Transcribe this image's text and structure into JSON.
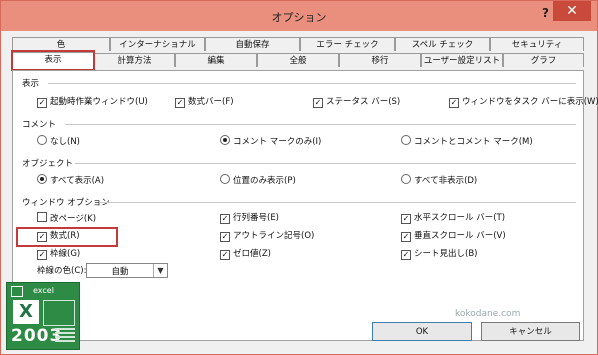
{
  "window": {
    "title": "オプション",
    "help_label": "?",
    "close_label": "✕"
  },
  "tabs_back": [
    "色",
    "インターナショナル",
    "自動保存",
    "エラー チェック",
    "スペル チェック",
    "セキュリティ"
  ],
  "tabs_front": [
    "表示",
    "計算方法",
    "編集",
    "全般",
    "移行",
    "ユーザー設定リスト",
    "グラフ"
  ],
  "active_tab": "表示",
  "sections": {
    "display": "表示",
    "comment": "コメント",
    "object": "オブジェクト",
    "window_options": "ウィンドウ オプション"
  },
  "display_items": [
    {
      "label": "起動時作業ウィンドウ(U)",
      "checked": true
    },
    {
      "label": "数式バー(F)",
      "checked": true
    },
    {
      "label": "ステータス バー(S)",
      "checked": true
    },
    {
      "label": "ウィンドウをタスク バーに表示(W)",
      "checked": true
    }
  ],
  "comment_items": [
    {
      "label": "なし(N)",
      "selected": false
    },
    {
      "label": "コメント マークのみ(I)",
      "selected": true
    },
    {
      "label": "コメントとコメント マーク(M)",
      "selected": false
    }
  ],
  "object_items": [
    {
      "label": "すべて表示(A)",
      "selected": true
    },
    {
      "label": "位置のみ表示(P)",
      "selected": false
    },
    {
      "label": "すべて非表示(D)",
      "selected": false
    }
  ],
  "window_items": [
    {
      "label": "改ページ(K)",
      "checked": false
    },
    {
      "label": "行列番号(E)",
      "checked": true
    },
    {
      "label": "水平スクロール バー(T)",
      "checked": true
    },
    {
      "label": "数式(R)",
      "checked": true
    },
    {
      "label": "アウトライン記号(O)",
      "checked": true
    },
    {
      "label": "垂直スクロール バー(V)",
      "checked": true
    },
    {
      "label": "枠線(G)",
      "checked": true
    },
    {
      "label": "ゼロ値(Z)",
      "checked": true
    },
    {
      "label": "シート見出し(B)",
      "checked": true
    }
  ],
  "gridline_color": {
    "label": "枠線の色(C):",
    "value": "自動"
  },
  "buttons": {
    "ok": "OK",
    "cancel": "キャンセル"
  },
  "watermark": "kokodane.com",
  "logo": {
    "label": "excel",
    "letter": "X",
    "year": "2003"
  },
  "colors": {
    "title_bar": "#ea8f7e",
    "close_button": "#c94a3a",
    "highlight": "#c23a3a",
    "logo_green": "#2e8b45"
  }
}
